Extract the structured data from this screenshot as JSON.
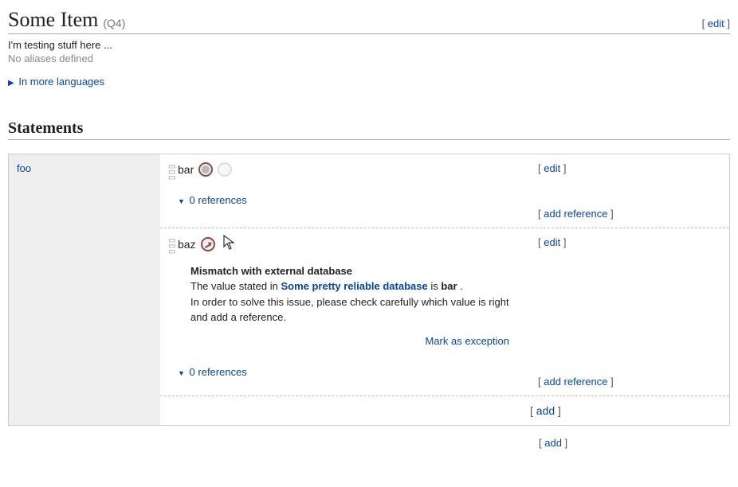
{
  "header": {
    "title": "Some Item",
    "id": "(Q4)",
    "edit": "edit",
    "description": "I'm testing stuff here ...",
    "aliases": "No aliases defined",
    "more_languages": "In more languages"
  },
  "statements": {
    "heading": "Statements",
    "property": "foo",
    "values": [
      {
        "value": "bar",
        "edit": "edit",
        "references": "0 references",
        "add_reference": "add reference"
      },
      {
        "value": "baz",
        "edit": "edit",
        "references": "0 references",
        "add_reference": "add reference",
        "mismatch": {
          "title": "Mismatch with external database",
          "prefix": "The value stated in ",
          "db": "Some pretty reliable database",
          "mid": " is ",
          "stated_value": "bar",
          "suffix": " .",
          "resolution": "In order to solve this issue, please check carefully which value is right and add a reference.",
          "mark_exception": "Mark as exception"
        }
      }
    ],
    "add": "add",
    "add_below": "add"
  }
}
